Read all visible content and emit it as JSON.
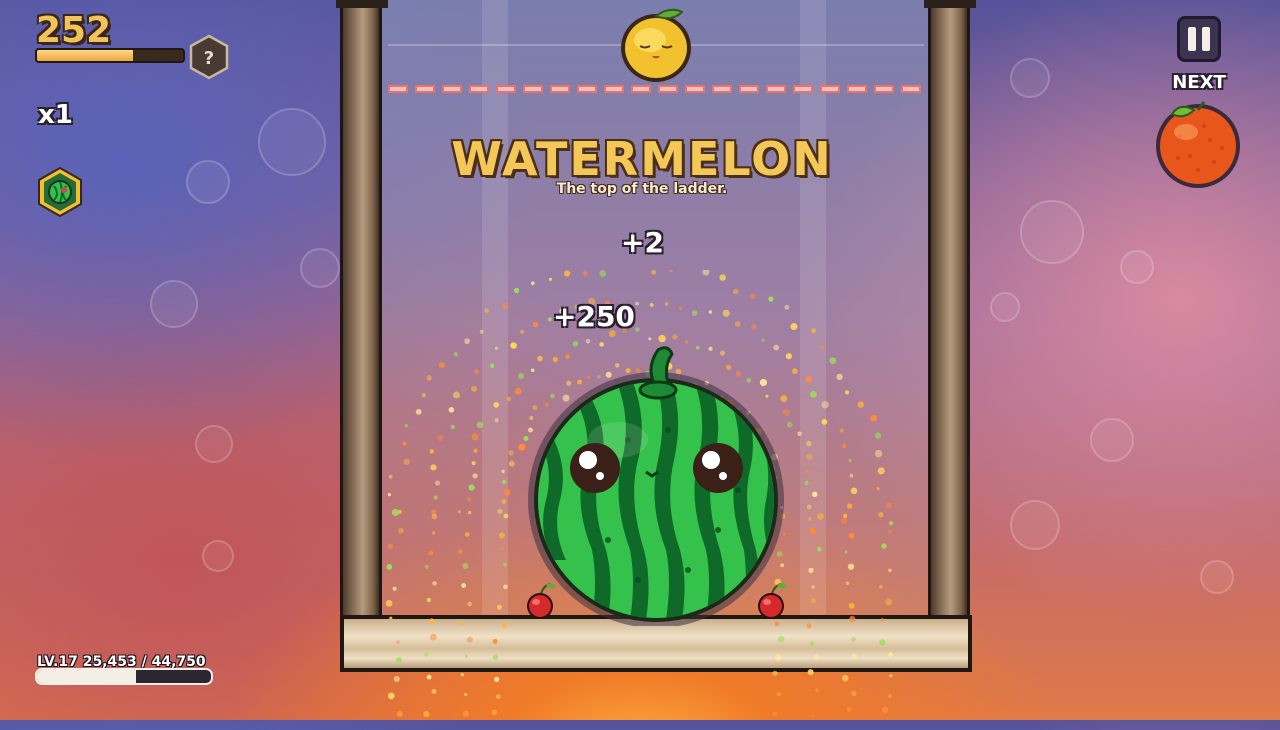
{
  "hud": {
    "score": "252",
    "score_progress": 0.66,
    "help_badge": "?",
    "multiplier": "x1",
    "powerup_icon": "watermelon-hex-icon",
    "pause_icon": "pause-icon",
    "next_label": "NEXT",
    "next_fruit": "orange"
  },
  "board": {
    "dropping_fruit": "lemon",
    "merged_fruit_title": "WATERMELON",
    "merged_fruit_subtitle": "The top of the ladder.",
    "popup_small": "+2",
    "popup_large": "+250",
    "fruits_in_jar": [
      "watermelon",
      "cherry",
      "cherry"
    ]
  },
  "level": {
    "text": "LV.17 25,453 / 44,750",
    "progress": 0.57
  },
  "colors": {
    "accent_gold": "#f2c35a",
    "watermelon_green": "#2fb54a",
    "danger_line": "#e6746c"
  }
}
